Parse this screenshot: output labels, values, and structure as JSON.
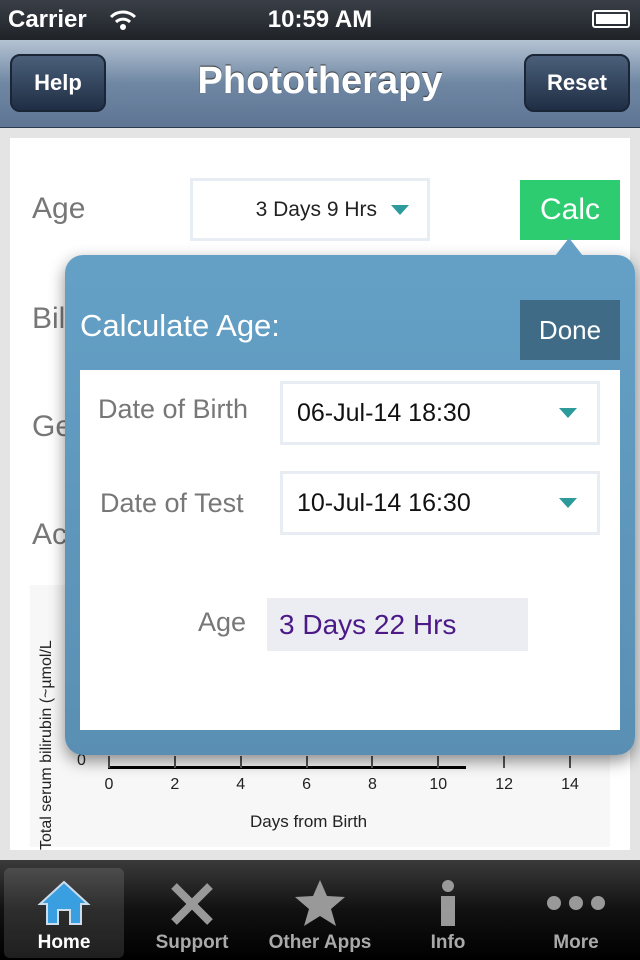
{
  "status_bar": {
    "carrier": "Carrier",
    "time": "10:59 AM"
  },
  "nav": {
    "title": "Phototherapy",
    "help": "Help",
    "reset": "Reset"
  },
  "form": {
    "age_label": "Age",
    "age_value": "3 Days 9 Hrs",
    "calc": "Calc",
    "bilirubin_label_partial": "Bil",
    "gestation_label_partial": "Ge",
    "ac_label_partial": "Ac"
  },
  "popover": {
    "title": "Calculate Age:",
    "done": "Done",
    "dob_label": "Date of Birth",
    "dob_value": "06-Jul-14 18:30",
    "dot_label": "Date of Test",
    "dot_value": "10-Jul-14 16:30",
    "age_label": "Age",
    "age_value": "3 Days 22 Hrs"
  },
  "chart_data": {
    "type": "line",
    "xlabel": "Days from Birth",
    "ylabel": "Total serum bilirubin (~µmol/L",
    "x_ticks": [
      "0",
      "2",
      "4",
      "6",
      "8",
      "10",
      "12",
      "14"
    ],
    "y_ticks_visible": [
      "0"
    ],
    "xlim": [
      0,
      14
    ]
  },
  "tabs": [
    {
      "label": "Home",
      "icon": "home-icon",
      "selected": true
    },
    {
      "label": "Support",
      "icon": "tools-icon"
    },
    {
      "label": "Other Apps",
      "icon": "star-icon"
    },
    {
      "label": "Info",
      "icon": "info-icon"
    },
    {
      "label": "More",
      "icon": "more-icon"
    }
  ],
  "colors": {
    "calc": "#2ecc71",
    "popover": "#5b93b9",
    "age_result": "#4b1a87"
  }
}
